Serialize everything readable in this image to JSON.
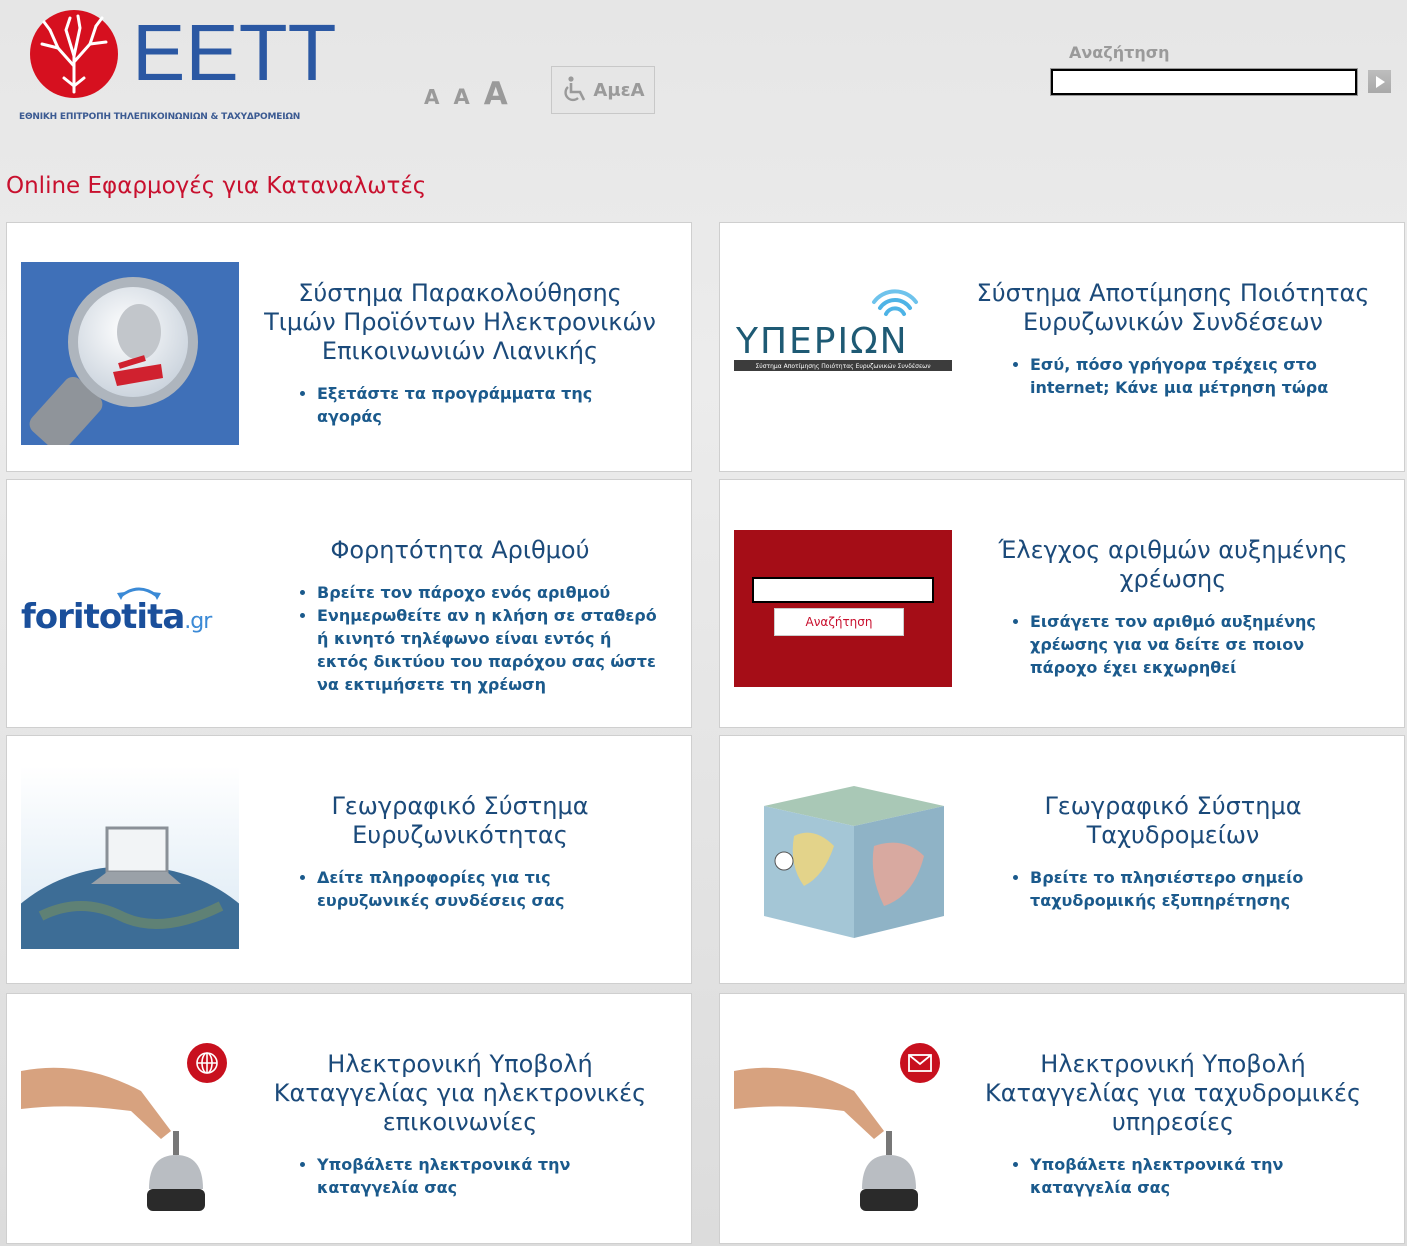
{
  "header": {
    "logo_text": "ΕΕΤΤ",
    "logo_subtitle": "ΕΘΝΙΚΗ ΕΠΙΤΡΟΠΗ ΤΗΛΕΠΙΚΟΙΝΩΝΙΩΝ & ΤΑΧΥΔΡΟΜΕΙΩΝ",
    "font_size_small": "A",
    "font_size_medium": "A",
    "font_size_large": "A",
    "accessibility_label": "ΑμεΑ",
    "search_label": "Αναζήτηση",
    "search_value": ""
  },
  "page_title": "Online Εφαρμογές για Καταναλωτές",
  "colors": {
    "brand_red": "#c8102e",
    "title_blue": "#1b4a7a",
    "link_blue": "#1b5a8c"
  },
  "cards": [
    {
      "title": "Σύστημα Παρακολούθησης Τιμών Προϊόντων Ηλεκτρονικών Επικοινωνιών Λιανικής",
      "bullets": [
        "Εξετάστε τα προγράμματα της αγοράς"
      ]
    },
    {
      "title": "Σύστημα Αποτίμησης Ποιότητας Ευρυζωνικών Συνδέσεων",
      "bullets": [
        "Εσύ, πόσο γρήγορα τρέχεις στο internet; Κάνε μια μέτρηση τώρα"
      ],
      "logo_text": "ΥΠΕΡΙΩΝ",
      "logo_caption": "Σύστημα Αποτίμησης Ποιότητας Ευρυζωνικών Συνδέσεων"
    },
    {
      "title": "Φορητότητα Αριθμού",
      "bullets": [
        "Βρείτε τον πάροχο ενός αριθμού",
        "Ενημερωθείτε αν η κλήση σε σταθερό ή κινητό τηλέφωνο είναι εντός ή εκτός δικτύου του παρόχου σας ώστε να εκτιμήσετε τη χρέωση"
      ],
      "logo_text_a": "foritotita",
      "logo_text_b": ".gr"
    },
    {
      "title": "Έλεγχος αριθμών αυξημένης χρέωσης",
      "bullets": [
        "Εισάγετε τον αριθμό αυξημένης χρέωσης για να δείτε σε ποιον πάροχο έχει εκχωρηθεί"
      ],
      "search_button": "Αναζήτηση"
    },
    {
      "title": "Γεωγραφικό Σύστημα Ευρυζωνικότητας",
      "bullets": [
        "Δείτε πληροφορίες για τις ευρυζωνικές συνδέσεις σας"
      ]
    },
    {
      "title": "Γεωγραφικό Σύστημα Ταχυδρομείων",
      "bullets": [
        "Βρείτε το πλησιέστερο σημείο ταχυδρομικής εξυπηρέτησης"
      ]
    },
    {
      "title": "Ηλεκτρονική Υποβολή Καταγγελίας για ηλεκτρονικές επικοινωνίες",
      "bullets": [
        "Υποβάλετε ηλεκτρονικά την καταγγελία σας"
      ]
    },
    {
      "title": "Ηλεκτρονική Υποβολή Καταγγελίας για ταχυδρομικές υπηρεσίες",
      "bullets": [
        "Υποβάλετε ηλεκτρονικά την καταγγελία σας"
      ]
    }
  ]
}
